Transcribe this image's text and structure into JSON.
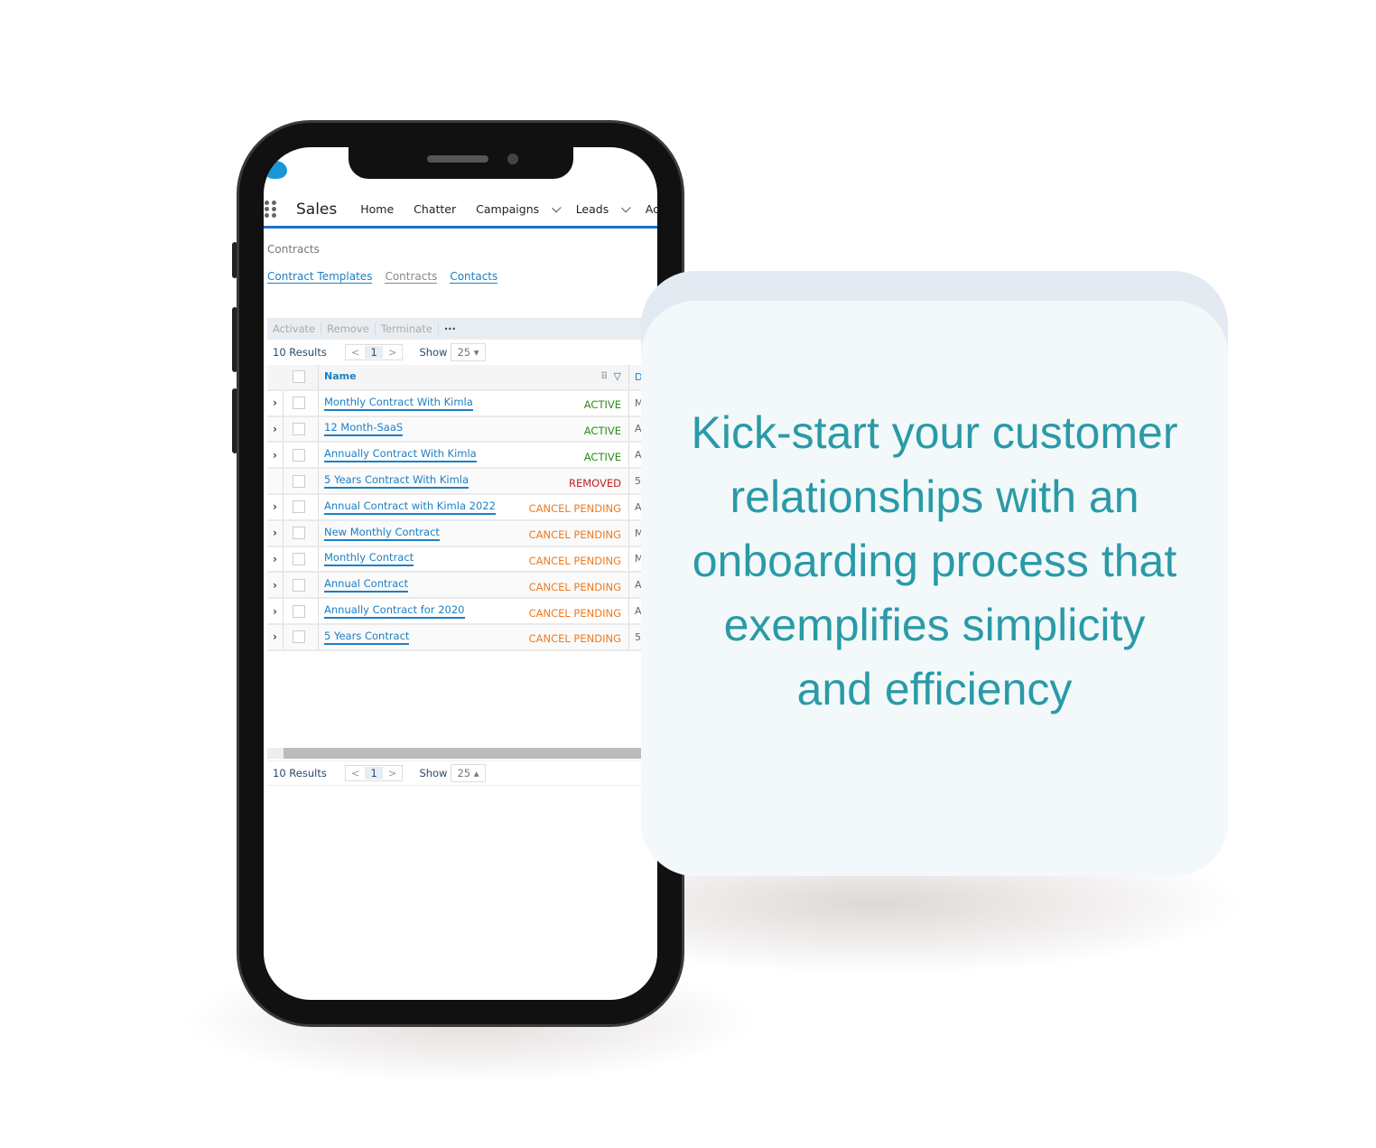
{
  "nav": {
    "app": "Sales",
    "items": [
      "Home",
      "Chatter",
      "Campaigns",
      "Leads",
      "Ac"
    ]
  },
  "breadcrumb": "Contracts",
  "links": [
    "Contract Templates",
    "Contracts",
    "Contacts"
  ],
  "actions": [
    "Activate",
    "Remove",
    "Terminate",
    "···"
  ],
  "pager": {
    "results": "10 Results",
    "prev": "<",
    "page": "1",
    "next": ">",
    "show": "Show",
    "size": "25"
  },
  "table": {
    "header": {
      "name": "Name",
      "next_col": "D"
    },
    "rows": [
      {
        "name": "Monthly Contract With Kimla",
        "status": "ACTIVE",
        "next": "M",
        "expandable": true
      },
      {
        "name": "12 Month-SaaS",
        "status": "ACTIVE",
        "next": "A",
        "expandable": true
      },
      {
        "name": "Annually Contract With Kimla",
        "status": "ACTIVE",
        "next": "A",
        "expandable": true
      },
      {
        "name": "5 Years Contract With Kimla",
        "status": "REMOVED",
        "next": "5",
        "expandable": false
      },
      {
        "name": "Annual Contract with Kimla 2022",
        "status": "CANCEL PENDING",
        "next": "A",
        "expandable": true
      },
      {
        "name": "New Monthly Contract",
        "status": "CANCEL PENDING",
        "next": "M",
        "expandable": true
      },
      {
        "name": "Monthly Contract",
        "status": "CANCEL PENDING",
        "next": "M",
        "expandable": true
      },
      {
        "name": "Annual Contract",
        "status": "CANCEL PENDING",
        "next": "A",
        "expandable": true
      },
      {
        "name": "Annually Contract for 2020",
        "status": "CANCEL PENDING",
        "next": "A",
        "expandable": true
      },
      {
        "name": "5 Years Contract",
        "status": "CANCEL PENDING",
        "next": "5",
        "expandable": true
      }
    ]
  },
  "status_colors": {
    "ACTIVE": "#2e8b17",
    "REMOVED": "#c41e1e",
    "CANCEL PENDING": "#f07a1e"
  },
  "headline": "Kick-start your customer relationships with an onboarding process that exemplifies simplicity and efficiency"
}
